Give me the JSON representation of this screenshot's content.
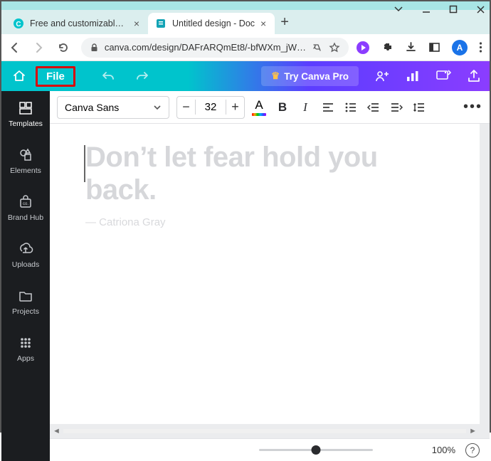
{
  "browser": {
    "tabs": [
      {
        "label": "Free and customizable Instag",
        "active": false,
        "favicon": "canva"
      },
      {
        "label": "Untitled design - Doc",
        "active": true,
        "favicon": "canva-doc"
      }
    ],
    "url": "canva.com/design/DAFrARQmEt8/-bfWXm_jW…",
    "avatar_initial": "A"
  },
  "app_header": {
    "file_label": "File",
    "try_pro_label": "Try Canva Pro"
  },
  "sidebar": {
    "items": [
      {
        "label": "Templates"
      },
      {
        "label": "Elements"
      },
      {
        "label": "Brand Hub"
      },
      {
        "label": "Uploads"
      },
      {
        "label": "Projects"
      },
      {
        "label": "Apps"
      }
    ]
  },
  "toolbar": {
    "font_name": "Canva Sans",
    "font_size": "32",
    "minus": "−",
    "plus": "+",
    "bold": "B",
    "italic": "I",
    "textcolor_a": "A",
    "more": "•••"
  },
  "document": {
    "quote": "Don’t let fear hold you back.",
    "author": "— Catriona Gray"
  },
  "bottom": {
    "zoom_label": "100%",
    "help": "?"
  },
  "scroll": {
    "left": "◄",
    "right": "►"
  }
}
